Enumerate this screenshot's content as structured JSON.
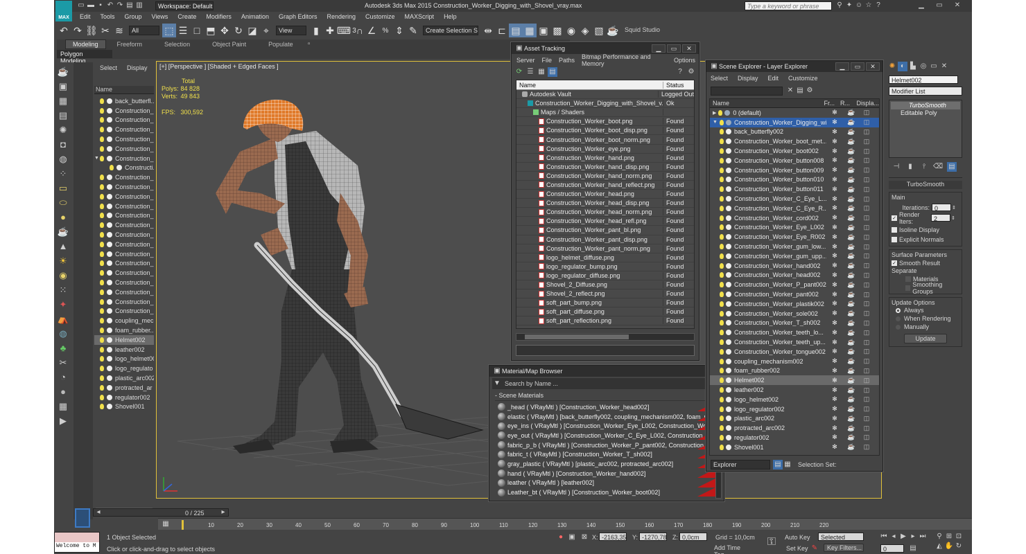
{
  "title_bar": {
    "workspace": "Workspace: Default",
    "title": "Autodesk 3ds Max  2015      Construction_Worker_Digging_with_Shovel_vray.max",
    "search_placeholder": "Type a keyword or phrase",
    "logo_text": "MAX"
  },
  "menu": [
    "Edit",
    "Tools",
    "Group",
    "Views",
    "Create",
    "Modifiers",
    "Animation",
    "Graph Editors",
    "Rendering",
    "Customize",
    "MAXScript",
    "Help"
  ],
  "toolbar": {
    "filter": "All",
    "coord": "View",
    "selection_set": "Create Selection Se",
    "studio": "Squid Studio v",
    "snap_label": "3",
    "pct_label": "%"
  },
  "ribbon": {
    "tabs": [
      "Modeling",
      "Freeform",
      "Selection",
      "Object Paint",
      "Populate"
    ],
    "active": "Modeling",
    "subtab": "Polygon Modeling"
  },
  "left_explorer": {
    "tabs": [
      "Select",
      "Display"
    ],
    "header": "Name",
    "items": [
      "back_butterfl...",
      "Construction_...",
      "Construction_...",
      "Construction_...",
      "Construction_...",
      "Construction_...",
      "Construction_...",
      "Constructi...",
      "Construction_...",
      "Construction_...",
      "Construction_...",
      "Construction_...",
      "Construction_...",
      "Construction_...",
      "Construction_...",
      "Construction_...",
      "Construction_...",
      "Construction_...",
      "Construction_...",
      "Construction_...",
      "Construction_...",
      "Construction_...",
      "Construction_...",
      "coupling_mec...",
      "foam_rubber...",
      "Helmet002",
      "leather002",
      "logo_helmet00",
      "logo_regulato",
      "plastic_arc002",
      "protracted_ar",
      "regulator002",
      "Shovel001"
    ],
    "selected": "Helmet002"
  },
  "viewport": {
    "label": "[+] [Perspective ] [Shaded + Edged Faces ]",
    "stats_header": "Total",
    "stats": [
      {
        "label": "Polys:",
        "value": "84 828"
      },
      {
        "label": "Verts:",
        "value": "49 843"
      }
    ],
    "fps_label": "FPS:",
    "fps": "300,592"
  },
  "asset_tracking": {
    "title": "Asset Tracking",
    "menu": [
      "Server",
      "File",
      "Paths",
      "Bitmap Performance and Memory",
      "Options"
    ],
    "col_name": "Name",
    "col_status": "Status",
    "rows": [
      {
        "name": "Autodesk Vault",
        "status": "Logged Out",
        "indent": 1,
        "kind": "vault"
      },
      {
        "name": "Construction_Worker_Digging_with_Shovel_v...",
        "status": "Ok",
        "indent": 2,
        "kind": "max"
      },
      {
        "name": "Maps / Shaders",
        "status": "",
        "indent": 3,
        "kind": "folder"
      },
      {
        "name": "Construction_Worker_boot.png",
        "status": "Found",
        "indent": 4,
        "kind": "png"
      },
      {
        "name": "Construction_Worker_boot_disp.png",
        "status": "Found",
        "indent": 4,
        "kind": "png"
      },
      {
        "name": "Construction_Worker_boot_norm.png",
        "status": "Found",
        "indent": 4,
        "kind": "png"
      },
      {
        "name": "Construction_Worker_eye.png",
        "status": "Found",
        "indent": 4,
        "kind": "png"
      },
      {
        "name": "Construction_Worker_hand.png",
        "status": "Found",
        "indent": 4,
        "kind": "png"
      },
      {
        "name": "Construction_Worker_hand_disp.png",
        "status": "Found",
        "indent": 4,
        "kind": "png"
      },
      {
        "name": "Construction_Worker_hand_norm.png",
        "status": "Found",
        "indent": 4,
        "kind": "png"
      },
      {
        "name": "Construction_Worker_hand_reflect.png",
        "status": "Found",
        "indent": 4,
        "kind": "png"
      },
      {
        "name": "Construction_Worker_head.png",
        "status": "Found",
        "indent": 4,
        "kind": "png"
      },
      {
        "name": "Construction_Worker_head_disp.png",
        "status": "Found",
        "indent": 4,
        "kind": "png"
      },
      {
        "name": "Construction_Worker_head_norm.png",
        "status": "Found",
        "indent": 4,
        "kind": "png"
      },
      {
        "name": "Construction_Worker_head_refl.png",
        "status": "Found",
        "indent": 4,
        "kind": "png"
      },
      {
        "name": "Construction_Worker_pant_bl.png",
        "status": "Found",
        "indent": 4,
        "kind": "png"
      },
      {
        "name": "Construction_Worker_pant_disp.png",
        "status": "Found",
        "indent": 4,
        "kind": "png"
      },
      {
        "name": "Construction_Worker_pant_norm.png",
        "status": "Found",
        "indent": 4,
        "kind": "png"
      },
      {
        "name": "logo_helmet_diffuse.png",
        "status": "Found",
        "indent": 4,
        "kind": "png"
      },
      {
        "name": "logo_regulator_bump.png",
        "status": "Found",
        "indent": 4,
        "kind": "png"
      },
      {
        "name": "logo_regulator_diffuse.png",
        "status": "Found",
        "indent": 4,
        "kind": "png"
      },
      {
        "name": "Shovel_2_Diffuse.png",
        "status": "Found",
        "indent": 4,
        "kind": "png"
      },
      {
        "name": "Shovel_2_reflect.png",
        "status": "Found",
        "indent": 4,
        "kind": "png"
      },
      {
        "name": "soft_part_bump.png",
        "status": "Found",
        "indent": 4,
        "kind": "png"
      },
      {
        "name": "soft_part_diffuse.png",
        "status": "Found",
        "indent": 4,
        "kind": "png"
      },
      {
        "name": "soft_part_reflection.png",
        "status": "Found",
        "indent": 4,
        "kind": "png"
      }
    ]
  },
  "material_browser": {
    "title": "Material/Map Browser",
    "search_placeholder": "Search by Name ...",
    "section": "- Scene Materials",
    "items": [
      "_head  ( VRayMtl ) [Construction_Worker_head002]",
      "elastic  ( VRayMtl ) [back_butterfly002, coupling_mechanism002, foam_rubber002]",
      "eye_ins  ( VRayMtl ) [Construction_Worker_Eye_L002, Construction_Worker_Eye...",
      "eye_out  ( VRayMtl ) [Construction_Worker_C_Eye_L002, Construction_Worker_C...",
      "fabric_p_b  ( VRayMtl ) [Construction_Worker_P_pant002, Construction_Worker_...",
      "fabric_t  ( VRayMtl ) [Construction_Worker_T_sh002]",
      "gray_plastic  ( VRayMtl ) [plastic_arc002, protracted_arc002]",
      "hand  ( VRayMtl ) [Construction_Worker_hand002]",
      "leather  ( VRayMtl ) [leather002]",
      "Leather_bt  ( VRayMtl ) [Construction_Worker_boot002]"
    ]
  },
  "scene_explorer": {
    "title": "Scene Explorer - Layer Explorer",
    "menu": [
      "Select",
      "Display",
      "Edit",
      "Customize"
    ],
    "col_name": "Name",
    "col_fr": "Fr...",
    "col_r": "R...",
    "col_disp": "Displa...",
    "rows": [
      {
        "name": "0 (default)",
        "indent": 0,
        "kind": "layer"
      },
      {
        "name": "Construction_Worker_Digging_with...",
        "indent": 0,
        "kind": "layer",
        "active": true
      },
      {
        "name": "back_butterfly002",
        "indent": 1
      },
      {
        "name": "Construction_Worker_boot_met...",
        "indent": 1
      },
      {
        "name": "Construction_Worker_boot002",
        "indent": 1
      },
      {
        "name": "Construction_Worker_button008",
        "indent": 1
      },
      {
        "name": "Construction_Worker_button009",
        "indent": 1
      },
      {
        "name": "Construction_Worker_button010",
        "indent": 1
      },
      {
        "name": "Construction_Worker_button011",
        "indent": 1
      },
      {
        "name": "Construction_Worker_C_Eye_L...",
        "indent": 1
      },
      {
        "name": "Construction_Worker_C_Eye_R...",
        "indent": 1
      },
      {
        "name": "Construction_Worker_cord002",
        "indent": 1
      },
      {
        "name": "Construction_Worker_Eye_L002",
        "indent": 1
      },
      {
        "name": "Construction_Worker_Eye_R002",
        "indent": 1
      },
      {
        "name": "Construction_Worker_gum_low...",
        "indent": 1
      },
      {
        "name": "Construction_Worker_gum_upp...",
        "indent": 1
      },
      {
        "name": "Construction_Worker_hand002",
        "indent": 1
      },
      {
        "name": "Construction_Worker_head002",
        "indent": 1
      },
      {
        "name": "Construction_Worker_P_pant002",
        "indent": 1
      },
      {
        "name": "Construction_Worker_pant002",
        "indent": 1
      },
      {
        "name": "Construction_Worker_plastik002",
        "indent": 1
      },
      {
        "name": "Construction_Worker_sole002",
        "indent": 1
      },
      {
        "name": "Construction_Worker_T_sh002",
        "indent": 1
      },
      {
        "name": "Construction_Worker_teeth_lo...",
        "indent": 1
      },
      {
        "name": "Construction_Worker_teeth_up...",
        "indent": 1
      },
      {
        "name": "Construction_Worker_tongue002",
        "indent": 1
      },
      {
        "name": "coupling_mechanism002",
        "indent": 1
      },
      {
        "name": "foam_rubber002",
        "indent": 1
      },
      {
        "name": "Helmet002",
        "indent": 1,
        "selected": true
      },
      {
        "name": "leather002",
        "indent": 1
      },
      {
        "name": "logo_helmet002",
        "indent": 1
      },
      {
        "name": "logo_regulator002",
        "indent": 1
      },
      {
        "name": "plastic_arc002",
        "indent": 1
      },
      {
        "name": "protracted_arc002",
        "indent": 1
      },
      {
        "name": "regulator002",
        "indent": 1
      },
      {
        "name": "Shovel001",
        "indent": 1
      }
    ],
    "footer_explorer": "Explorer",
    "footer_selset": "Selection Set:"
  },
  "command_panel": {
    "object_name": "Helmet002",
    "modifier_list": "Modifier List",
    "stack": [
      "TurboSmooth",
      "Editable Poly"
    ],
    "rollout": "TurboSmooth",
    "main": "Main",
    "iterations_label": "Iterations:",
    "iterations": "0",
    "render_iters_label": "Render Iters:",
    "render_iters": "2",
    "isoline": "Isoline Display",
    "explicit": "Explicit Normals",
    "surface": "Surface Parameters",
    "smooth_result": "Smooth Result",
    "separate": "Separate",
    "materials": "Materials",
    "smoothing_groups": "Smoothing Groups",
    "update_options": "Update Options",
    "always": "Always",
    "when_rendering": "When Rendering",
    "manually": "Manually",
    "update_btn": "Update"
  },
  "timeline": {
    "frame": "0 / 225",
    "ticks": [
      "10",
      "20",
      "30",
      "40",
      "50",
      "60",
      "70",
      "80",
      "90",
      "100",
      "110",
      "120",
      "130",
      "140",
      "150",
      "160",
      "170",
      "180",
      "190",
      "200",
      "210",
      "220"
    ]
  },
  "status": {
    "welcome": "Welcome to M",
    "selected": "1 Object Selected",
    "prompt": "Click or click-and-drag to select objects",
    "x": "-2163,356",
    "y": "-1270,782",
    "z": "0,0cm",
    "grid": "Grid = 10,0cm",
    "add_time_tag": "Add Time Tag",
    "auto_key": "Auto Key",
    "selected_dd": "Selected",
    "set_key": "Set Key",
    "key_filters": "Key Filters...",
    "frame_field": "0"
  }
}
